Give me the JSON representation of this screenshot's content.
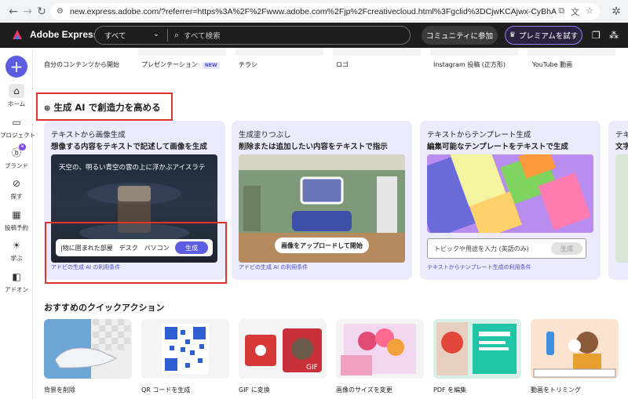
{
  "browser": {
    "url": "new.express.adobe.com/?referrer=https%3A%2F%2Fwww.adobe.com%2Fjp%2Fcreativecloud.html%3Fgclid%3DCjwKCAjwx-CyBhAiEiwAeOcTdSQpa0KzbSmO..."
  },
  "header": {
    "app_title": "Adobe Express",
    "search_scope": "すべて",
    "search_placeholder": "すべて検索",
    "community_label": "コミュニティに参加",
    "premium_label": "プレミアムを試す"
  },
  "rail": {
    "items": [
      {
        "label": "ホーム",
        "icon": "home-icon"
      },
      {
        "label": "プロジェクト",
        "icon": "folder-icon"
      },
      {
        "label": "ブランド",
        "icon": "brand-icon"
      },
      {
        "label": "探す",
        "icon": "discover-icon"
      },
      {
        "label": "投稿予約",
        "icon": "calendar-icon"
      },
      {
        "label": "学ぶ",
        "icon": "learn-icon"
      },
      {
        "label": "アドオン",
        "icon": "addon-icon"
      }
    ]
  },
  "top_row": {
    "items": [
      {
        "label": "自分のコンテンツから開始"
      },
      {
        "label": "プレゼンテーション",
        "badge": "NEW"
      },
      {
        "label": "チラシ"
      },
      {
        "label": "ロゴ"
      },
      {
        "label": "Instagram 投稿 (正方形)"
      },
      {
        "label": "YouTube 動画"
      }
    ]
  },
  "gen_ai": {
    "section_title": "生成 AI で創造力を高める",
    "cards": [
      {
        "title": "テキストから画像生成",
        "subtitle": "想像する内容をテキストで記述して画像を生成",
        "prompt": "天空の、明るい青空の雲の上に浮かぶアイスラテ",
        "chips": [
          "|物に囲まれた部屋",
          "デスク",
          "パソコン"
        ],
        "button": "生成",
        "link": "アドビの生成 AI の利用条件"
      },
      {
        "title": "生成塗りつぶし",
        "subtitle": "削除または追加したい内容をテキストで指示",
        "button": "画像をアップロードして開始",
        "link": "アドビの生成 AI の利用条件"
      },
      {
        "title": "テキストからテンプレート生成",
        "subtitle": "編集可能なテンプレートをテキストで生成",
        "placeholder": "トピックや用途を入力 (英語のみ)",
        "button": "生成",
        "link": "テキストからテンプレート生成の利用条件"
      },
      {
        "title": "テキ",
        "subtitle": "文字"
      }
    ]
  },
  "quick_actions": {
    "title": "おすすめのクイックアクション",
    "items": [
      {
        "label": "背景を削除"
      },
      {
        "label": "QR コードを生成"
      },
      {
        "label": "GIF に変換",
        "overlay": "GIF"
      },
      {
        "label": "画像のサイズを変更"
      },
      {
        "label": "PDF を編集"
      },
      {
        "label": "動画をトリミング"
      }
    ]
  }
}
